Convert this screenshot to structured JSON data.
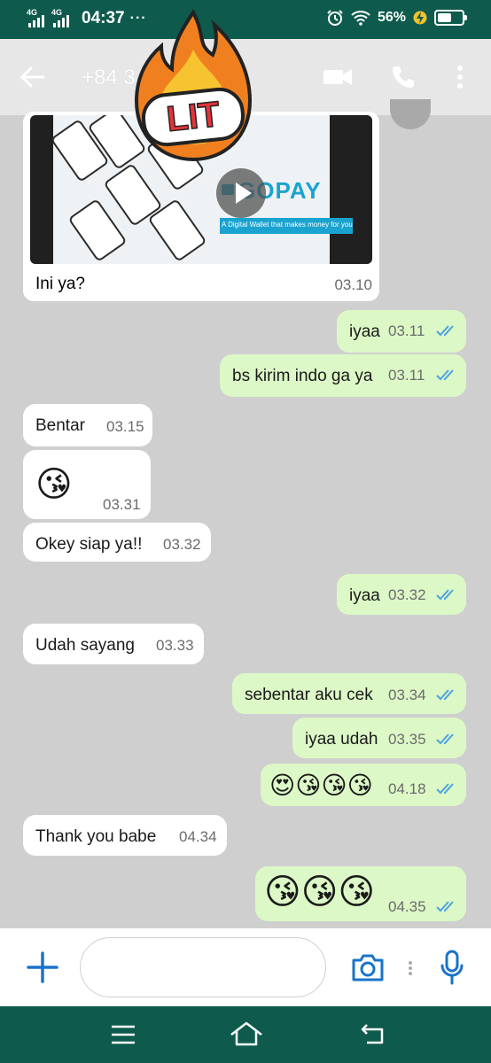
{
  "status_bar": {
    "network1": "4G",
    "network2": "4G",
    "time": "04:37",
    "more": "···",
    "battery_percent": "56%",
    "battery_level": 0.56
  },
  "header": {
    "title": "+84 3",
    "title_end": "0",
    "back_icon": "arrow-left-icon",
    "video_icon": "video-call-icon",
    "call_icon": "phone-icon",
    "menu_icon": "more-vert-icon"
  },
  "sticker": {
    "text": "LIT"
  },
  "media_message": {
    "brand": "GOPAY",
    "tagline": "A Digital Wallet that makes money for you",
    "caption": "Ini ya?",
    "time": "03.10"
  },
  "messages": [
    {
      "dir": "out",
      "text": "iyaa",
      "time": "03.11"
    },
    {
      "dir": "out",
      "text": "bs kirim indo ga ya",
      "time": "03.11"
    },
    {
      "dir": "in",
      "text": "Bentar",
      "time": "03.15"
    },
    {
      "dir": "in",
      "text": "😘",
      "time": "03.31"
    },
    {
      "dir": "in",
      "text": "Okey siap ya!!",
      "time": "03.32"
    },
    {
      "dir": "out",
      "text": "iyaa",
      "time": "03.32"
    },
    {
      "dir": "in",
      "text": "Udah sayang",
      "time": "03.33"
    },
    {
      "dir": "out",
      "text": "sebentar aku cek",
      "time": "03.34"
    },
    {
      "dir": "out",
      "text": "iyaa udah",
      "time": "03.35"
    },
    {
      "dir": "out",
      "text": "😍😘😘😘",
      "time": "04.18"
    },
    {
      "dir": "in",
      "text": "Thank you babe",
      "time": "04.34"
    },
    {
      "dir": "out",
      "text": "😘😘😘",
      "time": "04.35"
    }
  ],
  "input_bar": {
    "placeholder": "",
    "add_icon": "plus-icon",
    "camera_icon": "camera-icon",
    "mic_icon": "microphone-icon"
  },
  "nav_bar": {
    "menu_icon": "menu-icon",
    "home_icon": "home-icon",
    "back_icon": "back-icon"
  },
  "colors": {
    "status_bar": "#0e5b4d",
    "chat_bg": "#cfcfcf",
    "outgoing": "#dcf8c6",
    "incoming": "#ffffff",
    "read_ticks": "#4fa3e0",
    "accent": "#1a73c8"
  }
}
